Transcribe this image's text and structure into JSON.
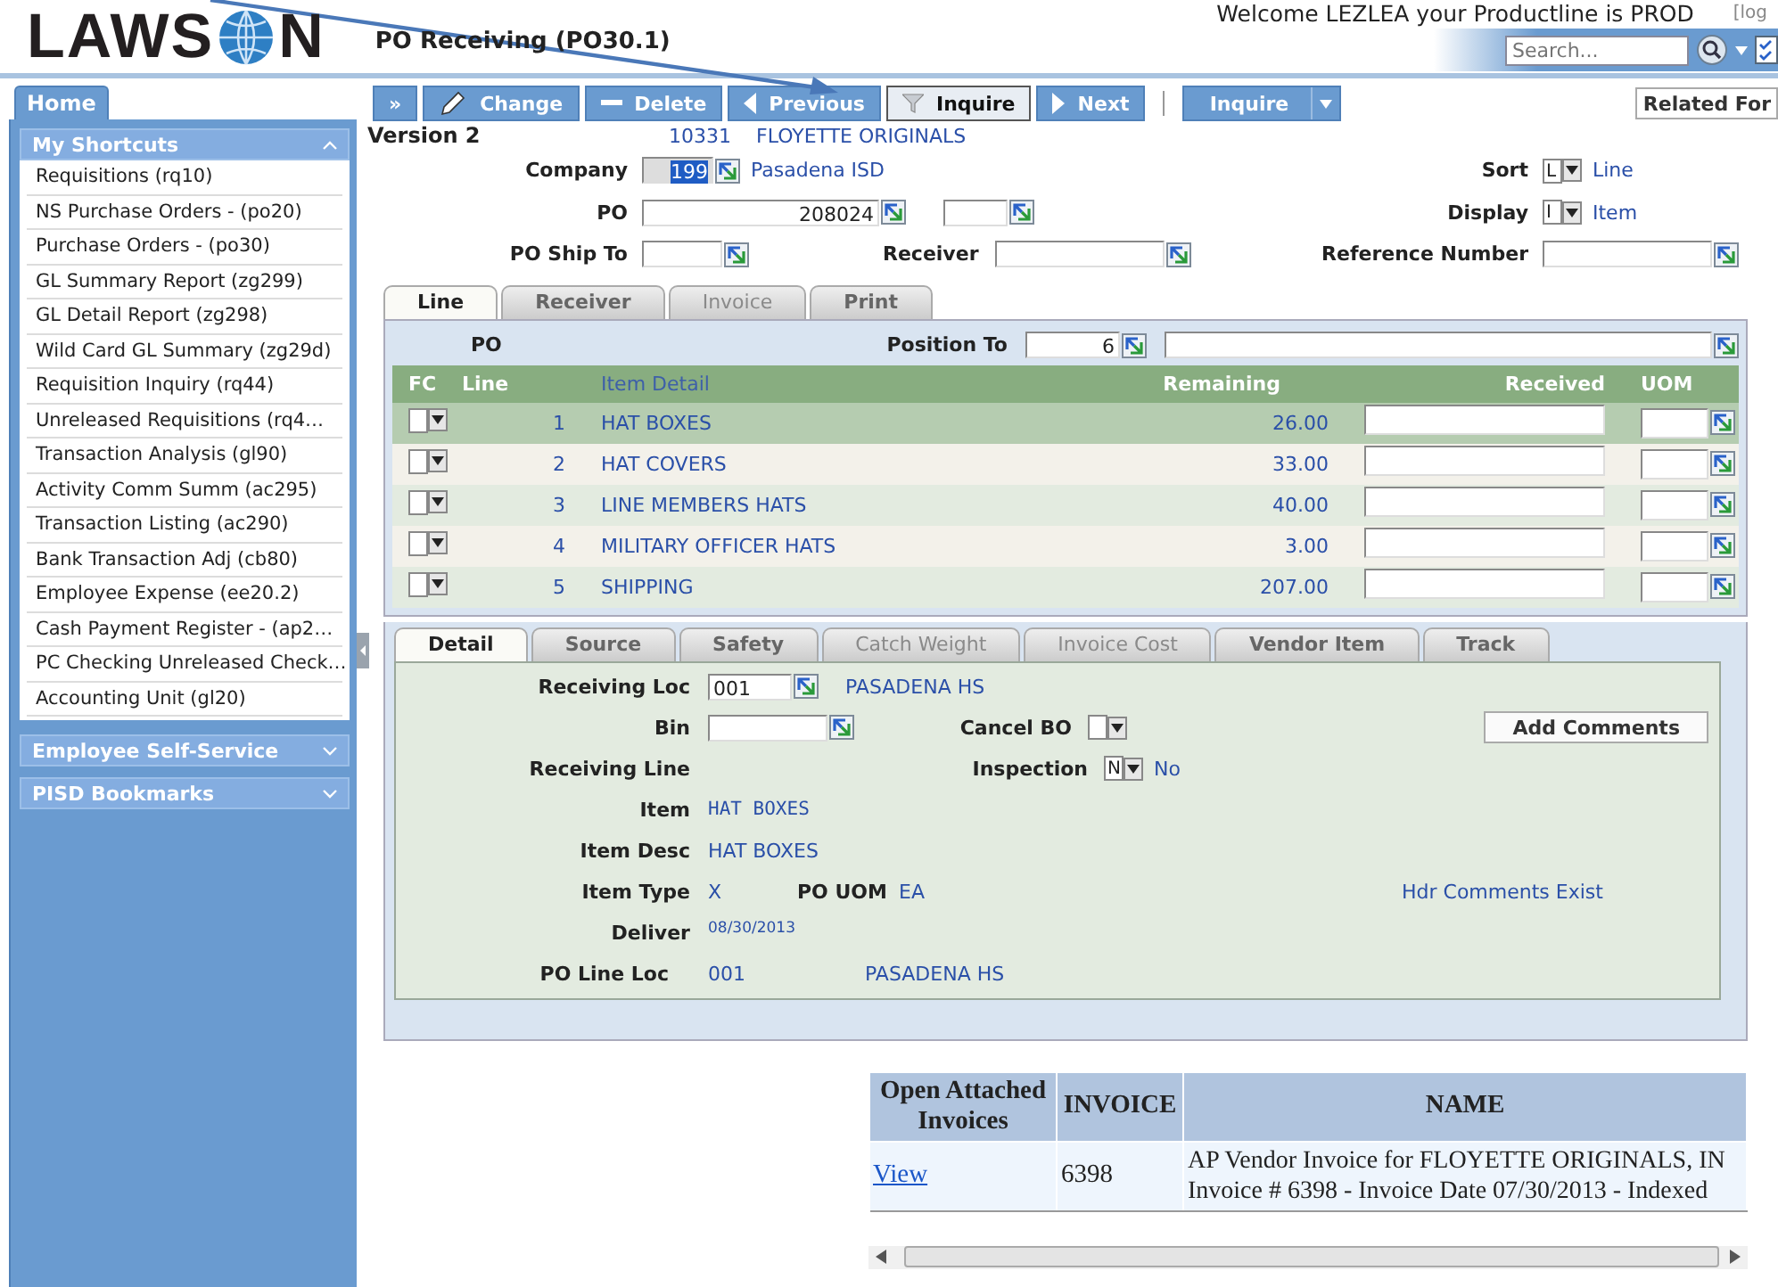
{
  "header": {
    "logo_start": "LAWS",
    "logo_end": "N",
    "title": "PO Receiving (PO30.1)",
    "welcome": "Welcome LEZLEA your Productline is PROD",
    "logout": "[log",
    "search": {
      "placeholder": "Search..."
    }
  },
  "sidebar": {
    "tab": "Home",
    "sections": [
      {
        "title": "My Shortcuts",
        "expanded": true,
        "items": [
          "Requisitions (rq10)",
          "NS Purchase Orders - (po20)",
          "Purchase Orders - (po30)",
          "GL Summary Report (zg299)",
          "GL Detail Report (zg298)",
          "Wild Card GL Summary (zg29d)",
          "Requisition Inquiry (rq44)",
          "Unreleased Requisitions (rq4…",
          "Transaction Analysis (gl90)",
          "Activity Comm Summ (ac295)",
          "Transaction Listing (ac290)",
          "Bank Transaction Adj (cb80)",
          "Employee Expense (ee20.2)",
          "Cash Payment Register - (ap2…",
          "PC Checking Unreleased Check…",
          "Accounting Unit (gl20)"
        ]
      },
      {
        "title": "Employee Self-Service",
        "expanded": false
      },
      {
        "title": "PISD Bookmarks",
        "expanded": false
      }
    ]
  },
  "toolbar": {
    "buttons": [
      {
        "kind": "expand",
        "label": "»",
        "selected": false
      },
      {
        "kind": "change",
        "label": "Change",
        "selected": false
      },
      {
        "kind": "delete",
        "label": "Delete",
        "selected": false
      },
      {
        "kind": "previous",
        "label": "Previous",
        "selected": false
      },
      {
        "kind": "inquire",
        "label": "Inquire",
        "selected": true
      },
      {
        "kind": "next",
        "label": "Next",
        "selected": false
      }
    ],
    "inquire_menu": "Inquire",
    "related": "Related For"
  },
  "form": {
    "version": "Version 2",
    "vendor_number": "10331",
    "vendor_name": "FLOYETTE ORIGINALS",
    "company": {
      "label": "Company",
      "value": "199",
      "name": "Pasadena ISD"
    },
    "po": {
      "label": "PO",
      "value": "208024"
    },
    "ship_to": {
      "label": "PO Ship To"
    },
    "receiver": {
      "label": "Receiver"
    },
    "sort": {
      "label": "Sort",
      "value": "L",
      "name": "Line"
    },
    "display": {
      "label": "Display",
      "value": "I",
      "name": "Item"
    },
    "reference": {
      "label": "Reference Number"
    }
  },
  "line_tabs": [
    {
      "label": "Line",
      "selected": true,
      "disabled": false
    },
    {
      "label": "Receiver",
      "selected": false,
      "disabled": false
    },
    {
      "label": "Invoice",
      "selected": false,
      "disabled": true
    },
    {
      "label": "Print",
      "selected": false,
      "disabled": false
    }
  ],
  "lines": {
    "po_label": "PO",
    "position_label": "Position To",
    "position_value": "6",
    "columns": [
      "FC",
      "Line",
      "Item Detail",
      "Remaining",
      "Received",
      "UOM"
    ],
    "rows": [
      {
        "line": "1",
        "item": "HAT BOXES",
        "remaining": "26.00",
        "selected": true
      },
      {
        "line": "2",
        "item": "HAT COVERS",
        "remaining": "33.00",
        "selected": false
      },
      {
        "line": "3",
        "item": "LINE MEMBERS HATS",
        "remaining": "40.00",
        "selected": false
      },
      {
        "line": "4",
        "item": "MILITARY OFFICER HATS",
        "remaining": "3.00",
        "selected": false
      },
      {
        "line": "5",
        "item": "SHIPPING",
        "remaining": "207.00",
        "selected": false
      }
    ]
  },
  "detail_tabs": [
    {
      "label": "Detail",
      "selected": true,
      "disabled": false
    },
    {
      "label": "Source",
      "selected": false,
      "disabled": false
    },
    {
      "label": "Safety",
      "selected": false,
      "disabled": false
    },
    {
      "label": "Catch Weight",
      "selected": false,
      "disabled": true
    },
    {
      "label": "Invoice Cost",
      "selected": false,
      "disabled": true
    },
    {
      "label": "Vendor Item",
      "selected": false,
      "disabled": false
    },
    {
      "label": "Track",
      "selected": false,
      "disabled": false
    }
  ],
  "detail": {
    "receiving_loc": {
      "label": "Receiving Loc",
      "value": "001",
      "name": "PASADENA HS"
    },
    "bin": {
      "label": "Bin"
    },
    "cancel_bo": {
      "label": "Cancel BO"
    },
    "add_comments": "Add Comments",
    "receiving_line": {
      "label": "Receiving Line"
    },
    "inspection": {
      "label": "Inspection",
      "value": "N",
      "name": "No"
    },
    "item": {
      "label": "Item",
      "value": "HAT BOXES"
    },
    "item_desc": {
      "label": "Item Desc",
      "value": "HAT BOXES"
    },
    "item_type": {
      "label": "Item Type",
      "value": "X"
    },
    "po_uom": {
      "label": "PO UOM",
      "value": "EA"
    },
    "hdr_comments": "Hdr Comments Exist",
    "deliver": {
      "label": "Deliver",
      "value": "08/30/2013"
    },
    "po_line_loc": {
      "label": "PO Line Loc",
      "value": "001",
      "name": "PASADENA HS"
    }
  },
  "invoices": {
    "columns": [
      "Open Attached Invoices",
      "INVOICE",
      "NAME"
    ],
    "rows": [
      {
        "link": "View",
        "invoice": "6398",
        "name_lines": [
          "AP Vendor Invoice for FLOYETTE ORIGINALS, IN",
          "Invoice # 6398 - Invoice Date 07/30/2013 - Indexed"
        ]
      }
    ]
  }
}
